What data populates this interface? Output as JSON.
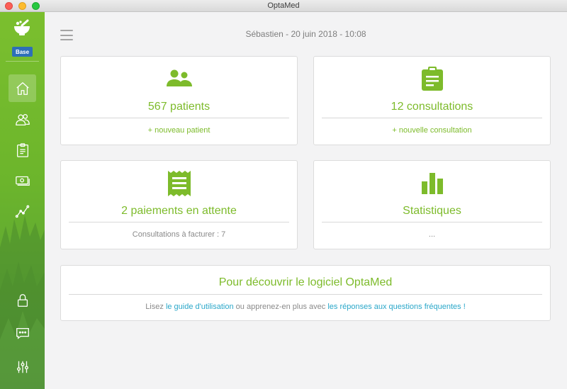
{
  "window": {
    "title": "OptaMed"
  },
  "sidebar": {
    "logo_icon": "mortar-pestle-icon",
    "badge": "Base",
    "nav": [
      {
        "id": "home",
        "icon": "home-icon",
        "active": true
      },
      {
        "id": "patients",
        "icon": "users-icon",
        "active": false
      },
      {
        "id": "consultations",
        "icon": "clipboard-icon",
        "active": false
      },
      {
        "id": "payments",
        "icon": "money-icon",
        "active": false
      },
      {
        "id": "stats",
        "icon": "chart-line-icon",
        "active": false
      }
    ],
    "bottom": [
      {
        "id": "lock",
        "icon": "lock-icon"
      },
      {
        "id": "messages",
        "icon": "chat-icon"
      },
      {
        "id": "settings",
        "icon": "sliders-icon"
      }
    ]
  },
  "header": {
    "text": "Sébastien - 20 juin 2018 - 10:08"
  },
  "cards": {
    "patients": {
      "icon": "users-icon",
      "title": "567 patients",
      "link": "+ nouveau patient"
    },
    "consultations": {
      "icon": "clipboard-icon",
      "title": "12 consultations",
      "link": "+ nouvelle consultation"
    },
    "payments": {
      "icon": "receipt-icon",
      "title": "2 paiements en attente",
      "subtitle": "Consultations à facturer : 7"
    },
    "stats": {
      "icon": "bar-chart-icon",
      "title": "Statistiques",
      "subtitle": "..."
    }
  },
  "discover": {
    "title": "Pour découvrir le logiciel OptaMed",
    "text_before": "Lisez",
    "link1": "le guide d'utilisation",
    "text_middle": "ou apprenez-en plus avec",
    "link2": "les réponses aux questions fréquentes !"
  },
  "colors": {
    "accent": "#7dbb2b",
    "link": "#2aa7c9",
    "badge": "#2d6fb8"
  }
}
